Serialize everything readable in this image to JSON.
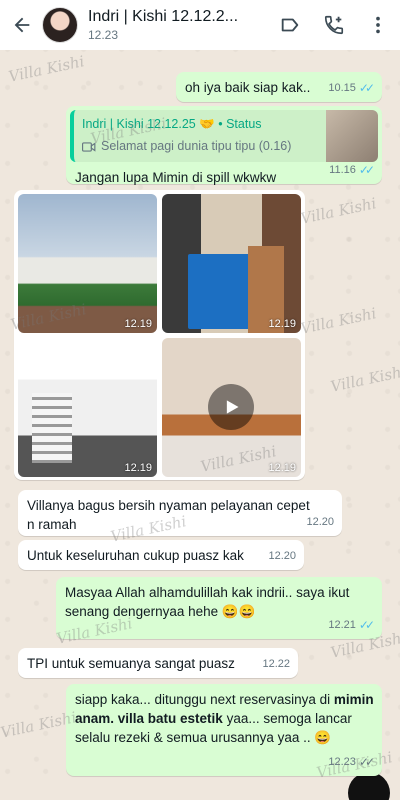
{
  "header": {
    "title": "Indri | Kishi 12.12.2...",
    "subtitle": "12.23"
  },
  "watermark": "Villa Kishi",
  "messages": [
    {
      "text": "oh iya baik siap kak..",
      "time": "10.15"
    },
    {
      "quote_author": "Indri | Kishi 12.12.25 🤝 • Status",
      "quote_text": "Selamat pagi dunia tipu tipu (0.16)",
      "text": "Jangan lupa Mimin di spill wkwkw",
      "time": "11.16"
    },
    {
      "text": "Villanya bagus bersih nyaman pelayanan cepet n ramah",
      "time": "12.20"
    },
    {
      "text": "Untuk keseluruhan cukup puasz kak",
      "time": "12.20"
    },
    {
      "text": "Masyaa Allah alhamdulillah kak indrii.. saya ikut senang dengernyaa hehe 😄😄",
      "time": "12.21"
    },
    {
      "text": "TPI untuk semuanya sangat puasz",
      "time": "12.22"
    },
    {
      "text_pre": "siapp kaka... ditunggu next reservasinya di ",
      "text_bold": "mimin anam. villa batu estetik",
      "text_post": " yaa... semoga lancar selalu rezeki & semua urusannya yaa .. 😄",
      "time": "12.23"
    }
  ],
  "media": [
    {
      "time": "12.19",
      "kind": "photo"
    },
    {
      "time": "12.19",
      "kind": "photo"
    },
    {
      "time": "12.19",
      "kind": "photo"
    },
    {
      "time": "12.19",
      "kind": "video"
    }
  ],
  "colors": {
    "outgoing": "#d9fdd3",
    "incoming": "#ffffff",
    "tick": "#53bdeb",
    "quote_bar": "#06cf9c"
  },
  "icons": [
    "back-arrow-icon",
    "label-icon",
    "add-call-icon",
    "more-vert-icon",
    "play-icon",
    "double-check-icon",
    "video-icon"
  ]
}
